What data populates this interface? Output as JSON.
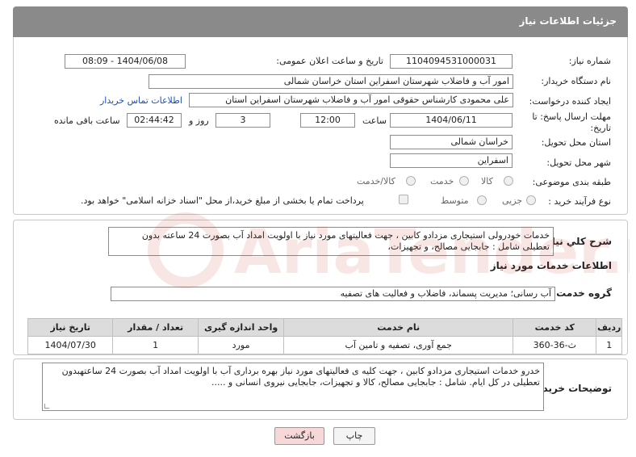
{
  "header": {
    "title": "جزئیات اطلاعات نیاز"
  },
  "form": {
    "need_number_label": "شماره نیاز:",
    "need_number": "1104094531000031",
    "announce_label": "تاریخ و ساعت اعلان عمومی:",
    "announce_value": "1404/06/08 - 08:09",
    "buyer_org_label": "نام دستگاه خریدار:",
    "buyer_org": "امور آب و فاضلاب شهرستان اسفراین استان خراسان شمالی",
    "requester_label": "ایجاد کننده درخواست:",
    "requester": "علی  محمودی  کارشناس حقوقی امور آب و فاضلاب شهرستان اسفراین استان",
    "contact_link": "اطلاعات تماس خریدار",
    "deadline_label": "مهلت ارسال پاسخ: تا تاریخ:",
    "deadline_date": "1404/06/11",
    "time_label": "ساعت",
    "deadline_time": "12:00",
    "days_value": "3",
    "days_label": "روز و",
    "remaining_time": "02:44:42",
    "remaining_label": "ساعت باقی مانده",
    "province_label": "استان محل تحویل:",
    "province": "خراسان شمالی",
    "city_label": "شهر محل تحویل:",
    "city": "اسفراین",
    "category_label": "طبقه بندی موضوعی:",
    "category_options": [
      "کالا",
      "خدمت",
      "کالا/خدمت"
    ],
    "process_label": "نوع فرآیند خرید :",
    "process_options": [
      "جزیی",
      "متوسط"
    ],
    "payment_note": "پرداخت تمام یا بخشی از مبلغ خرید،از محل \"اسناد خزانه اسلامی\" خواهد بود."
  },
  "summary": {
    "label": "شرح کلي نياز:",
    "text": "خدمات خودرولی استیجاری مزدادو کابین ، جهت  فعالیتهای مورد نیاز با اولویت امداد آب بصورت 24 ساعته بدون تعطیلی شامل : جابجایی مصالح، و تجهیزات،"
  },
  "services": {
    "section_title": "اطلاعات خدمات مورد نیاز",
    "group_label": "گروه خدمت:",
    "group_value": "آب رسانی؛ مدیریت پسماند، فاضلاب و فعالیت های تصفیه",
    "columns": [
      "ردیف",
      "کد خدمت",
      "نام خدمت",
      "واحد اندازه گیری",
      "تعداد / مقدار",
      "تاریخ نیاز"
    ],
    "rows": [
      [
        "1",
        "ث-36-360",
        "جمع آوری، تصفیه و تامین آب",
        "مورد",
        "1",
        "1404/07/30"
      ]
    ]
  },
  "buyer_notes": {
    "label": "توضیحات خریدار:",
    "text": "خدرو خدمات استیجاری مزدادو کابین ، جهت کلیه ی فعالیتهای مورد نیاز بهره برداری آب با اولویت امداد آب بصورت 24 ساعتهبدون تعطیلی در کل ایام. شامل : جابجایی مصالح، کالا و تجهیزات، جابجایی نیروی انسانی و ....."
  },
  "buttons": {
    "print": "چاپ",
    "back": "بازگشت"
  },
  "watermark": "AriaTender.neT",
  "colors": {
    "header": "#8a8a8a",
    "link": "#1a4fb8",
    "back_button": "#f7d7d7",
    "watermark": "#c0392b"
  }
}
